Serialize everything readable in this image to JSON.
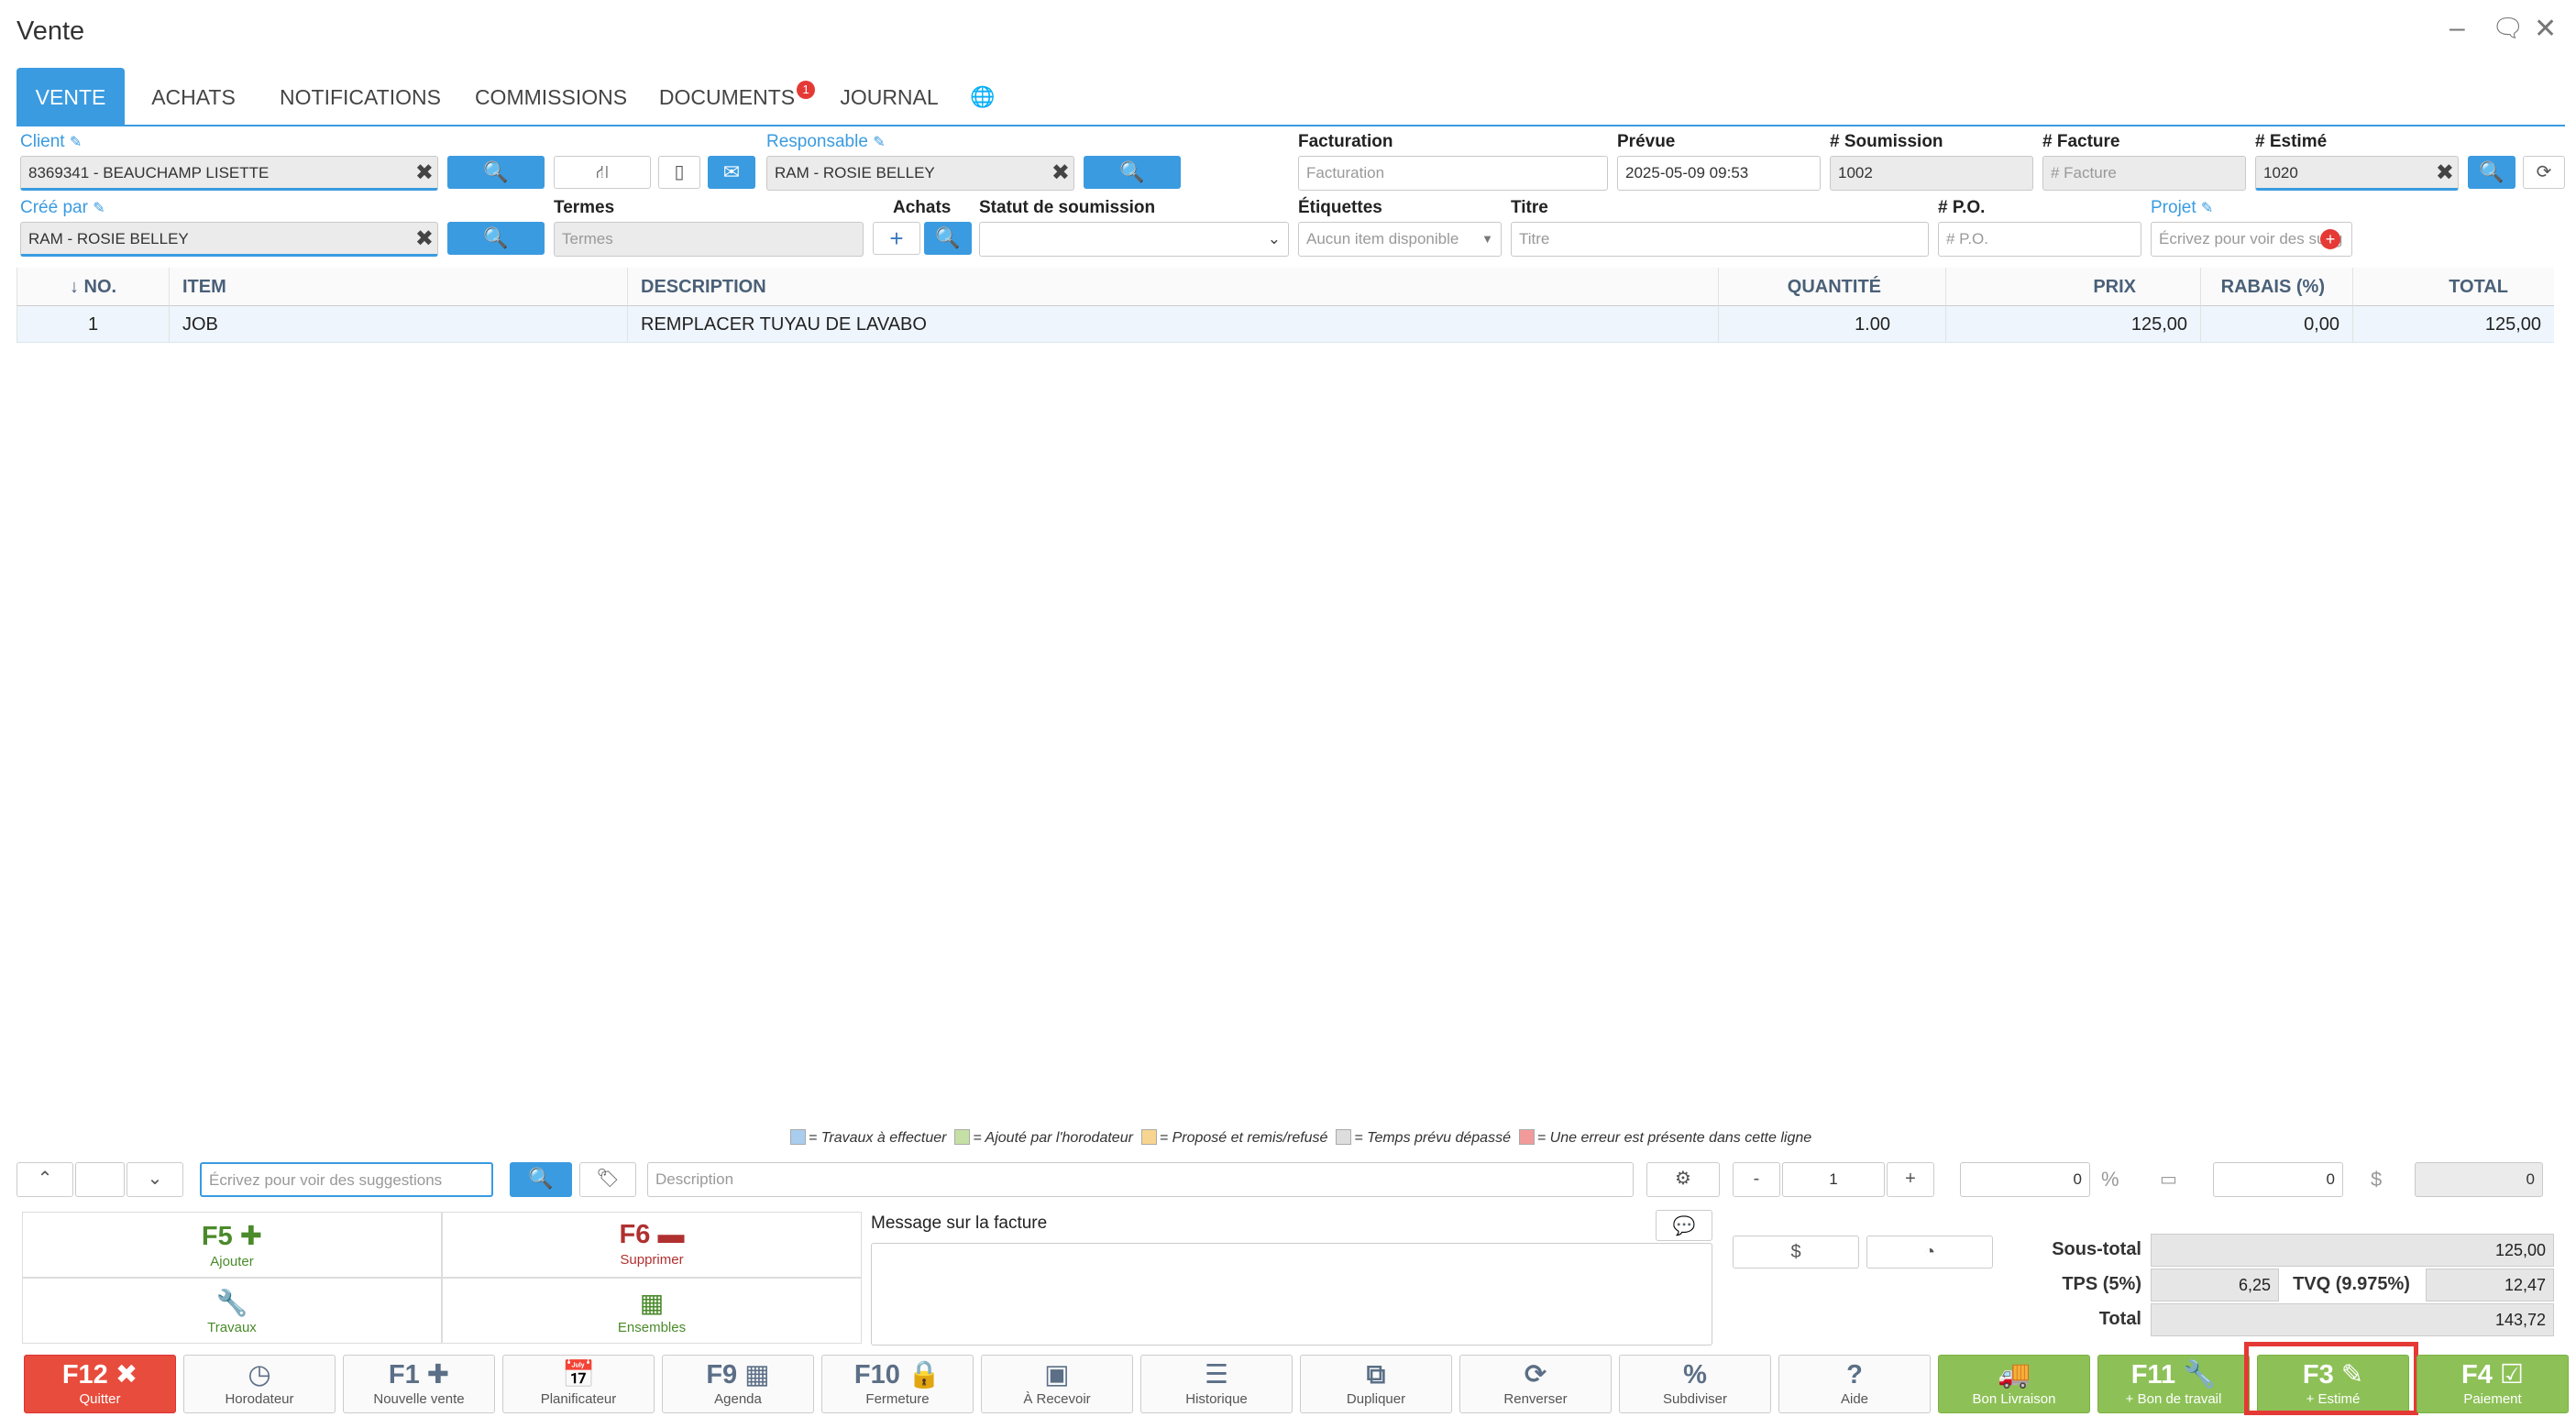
{
  "window": {
    "title": "Vente",
    "minimize": "–",
    "chat": "🗨",
    "close": "✕"
  },
  "tabs": [
    {
      "label": "VENTE"
    },
    {
      "label": "ACHATS"
    },
    {
      "label": "NOTIFICATIONS"
    },
    {
      "label": "COMMISSIONS"
    },
    {
      "label": "DOCUMENTS",
      "badge": "1"
    },
    {
      "label": "JOURNAL"
    }
  ],
  "header": {
    "client_label": "Client",
    "client_value": "8369341 - BEAUCHAMP LISETTE",
    "responsable_label": "Responsable",
    "responsable_value": "RAM - ROSIE BELLEY",
    "facturation_label": "Facturation",
    "facturation_placeholder": "Facturation",
    "prevue_label": "Prévue",
    "prevue_value": "2025-05-09 09:53",
    "soumission_label": "# Soumission",
    "soumission_value": "1002",
    "facture_label": "# Facture",
    "facture_placeholder": "# Facture",
    "estime_label": "# Estimé",
    "estime_value": "1020",
    "cree_par_label": "Créé par",
    "cree_par_value": "RAM - ROSIE BELLEY",
    "termes_label": "Termes",
    "termes_placeholder": "Termes",
    "achats_label": "Achats",
    "statut_label": "Statut de soumission",
    "statut_value": "",
    "etiquettes_label": "Étiquettes",
    "etiquettes_value": "Aucun item disponible",
    "titre_label": "Titre",
    "titre_placeholder": "Titre",
    "po_label": "# P.O.",
    "po_placeholder": "# P.O.",
    "projet_label": "Projet",
    "projet_placeholder": "Écrivez pour voir des sugg"
  },
  "table": {
    "headers": [
      "↓ NO.",
      "ITEM",
      "DESCRIPTION",
      "QUANTITÉ",
      "PRIX",
      "RABAIS (%)",
      "TOTAL"
    ],
    "rows": [
      {
        "no": "1",
        "item": "JOB",
        "description": "REMPLACER TUYAU DE LAVABO",
        "qty": "1.00",
        "prix": "125,00",
        "rabais": "0,00",
        "total": "125,00"
      }
    ]
  },
  "legend": [
    {
      "text": "= Travaux à effectuer",
      "color": "#a9cdee"
    },
    {
      "text": "= Ajouté par l'horodateur",
      "color": "#c5e0a5"
    },
    {
      "text": "= Proposé et remis/refusé",
      "color": "#f7d590"
    },
    {
      "text": "= Temps prévu dépassé",
      "color": "#dddddd"
    },
    {
      "text": "= Une erreur est présente dans cette ligne",
      "color": "#f29a9a"
    }
  ],
  "entry": {
    "search_placeholder": "Écrivez pour voir des suggestions",
    "description_placeholder": "Description",
    "qty": "1",
    "minus": "-",
    "plus": "+",
    "discount": "0",
    "pct": "%",
    "price": "0",
    "dollar": "$",
    "total": "0"
  },
  "actions": {
    "f5_key": "F5",
    "f5_label": "Ajouter",
    "f6_key": "F6",
    "f6_label": "Supprimer",
    "travaux_label": "Travaux",
    "ensembles_label": "Ensembles"
  },
  "message": {
    "label": "Message sur la facture",
    "value": ""
  },
  "totals": {
    "soustotal_label": "Sous-total",
    "soustotal": "125,00",
    "tps_label": "TPS (5%)",
    "tps": "6,25",
    "tvq_label": "TVQ (9.975%)",
    "tvq": "12,47",
    "total_label": "Total",
    "total": "143,72",
    "dollar_btn": "$"
  },
  "fkeys": [
    {
      "key": "F12",
      "label": "Quitter"
    },
    {
      "key": "",
      "label": "Horodateur"
    },
    {
      "key": "F1",
      "label": "Nouvelle vente"
    },
    {
      "key": "",
      "label": "Planificateur"
    },
    {
      "key": "F9",
      "label": "Agenda"
    },
    {
      "key": "F10",
      "label": "Fermeture"
    },
    {
      "key": "",
      "label": "À Recevoir"
    },
    {
      "key": "",
      "label": "Historique"
    },
    {
      "key": "",
      "label": "Dupliquer"
    },
    {
      "key": "",
      "label": "Renverser"
    },
    {
      "key": "",
      "label": "Subdiviser"
    },
    {
      "key": "",
      "label": "Aide"
    },
    {
      "key": "",
      "label": "Bon Livraison"
    },
    {
      "key": "F11",
      "label": "+ Bon de travail"
    },
    {
      "key": "F3",
      "label": "+ Estimé"
    },
    {
      "key": "F4",
      "label": "Paiement"
    }
  ],
  "colors": {
    "accent": "#3a9be0",
    "red": "#e74c3c",
    "green": "#8dc157",
    "highlight": "#e53935"
  }
}
